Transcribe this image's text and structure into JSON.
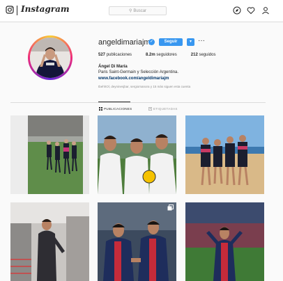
{
  "header": {
    "logo_text": "Instagram",
    "search_placeholder": "Buscar",
    "icons": [
      "instagram-camera-icon",
      "compass-icon",
      "heart-icon",
      "user-icon"
    ]
  },
  "profile": {
    "username": "angeldimariajm",
    "verified": true,
    "follow_label": "Seguir",
    "dropdown_label": "▾",
    "more_label": "···",
    "stats": {
      "posts": "527",
      "posts_label": "publicaciones",
      "followers": "8.2m",
      "followers_label": "seguidores",
      "following": "212",
      "following_label": "seguidos"
    },
    "full_name": "Ángel Di María",
    "bio": "Paris Saint-Germain y Selección Argentina.",
    "website": "www.facebook.com/angeldimariajm",
    "followed_by_text": "Seguido por",
    "followed_by_users": "tbehhOl, deyninesjbar, sergiomanora",
    "followed_by_more": "y 15 más siguen esta cuenta"
  },
  "tabs": {
    "posts_label": "PUBLICACIONES",
    "tagged_label": "ETIQUETADAS"
  },
  "colors": {
    "accent": "#3897f0",
    "text": "#262626",
    "muted": "#8e8e8e",
    "link": "#003569",
    "border": "#dbdbdb",
    "background": "#fafafa"
  },
  "posts": [
    {
      "type": "photo",
      "subject": "training-pitch"
    },
    {
      "type": "photo",
      "subject": "three-players-selfie"
    },
    {
      "type": "photo",
      "subject": "team-on-beach"
    },
    {
      "type": "photo",
      "subject": "player-in-stands"
    },
    {
      "type": "carousel",
      "subject": "match-handshake"
    },
    {
      "type": "photo",
      "subject": "match-night-stadium"
    }
  ]
}
